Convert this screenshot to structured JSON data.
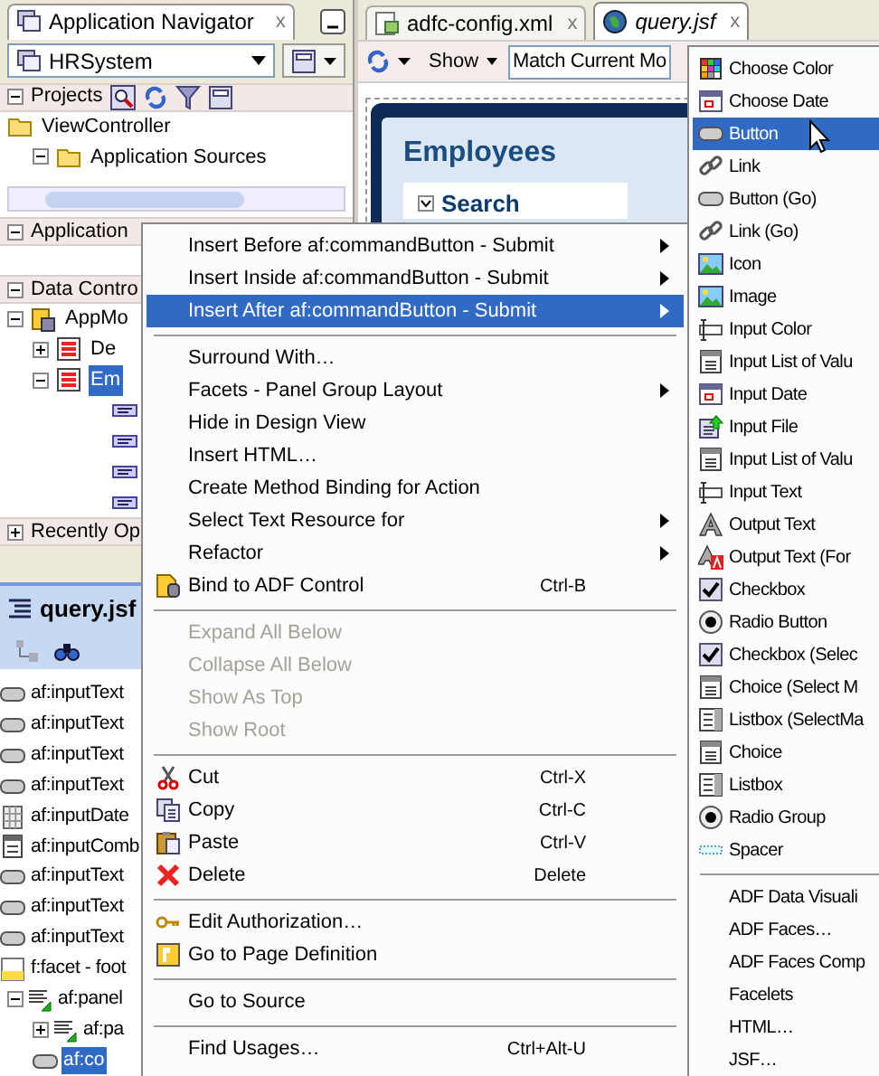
{
  "navigator": {
    "tab": {
      "label": "Application Navigator",
      "close": "x"
    },
    "application": "HRSystem",
    "projects": {
      "title": "Projects",
      "expanded": true,
      "tree": [
        {
          "label": "ViewController",
          "children": [
            {
              "label": "Application Sources",
              "expanded": true
            }
          ]
        }
      ]
    },
    "resources": {
      "title": "Application",
      "expanded": true
    },
    "data_controls": {
      "title": "Data Contro",
      "expanded": true,
      "tree": [
        {
          "label": "AppMo",
          "expanded": true,
          "selected": false,
          "children": [
            {
              "label": "De",
              "expanded": false,
              "selected": false
            },
            {
              "label": "Em",
              "expanded": true,
              "selected": true
            }
          ]
        }
      ]
    },
    "recent": {
      "title": "Recently Op",
      "expanded": false
    }
  },
  "structure": {
    "title": "query.jsf",
    "items": [
      {
        "kind": "text",
        "label": "af:inputText",
        "selected": false
      },
      {
        "kind": "text",
        "label": "af:inputText",
        "selected": false
      },
      {
        "kind": "text",
        "label": "af:inputText",
        "selected": false
      },
      {
        "kind": "text",
        "label": "af:inputText",
        "selected": false
      },
      {
        "kind": "date",
        "label": "af:inputDate",
        "selected": false
      },
      {
        "kind": "combo",
        "label": "af:inputComb",
        "selected": false
      },
      {
        "kind": "text",
        "label": "af:inputText",
        "selected": false
      },
      {
        "kind": "text",
        "label": "af:inputText",
        "selected": false
      },
      {
        "kind": "text",
        "label": "af:inputText",
        "selected": false
      },
      {
        "kind": "facet",
        "label": "f:facet - foot",
        "selected": false,
        "children": [
          {
            "kind": "panel",
            "label": "af:panel",
            "selected": false,
            "expanded": true,
            "children": [
              {
                "kind": "panel",
                "label": "af:pa",
                "selected": false,
                "expanded": false
              },
              {
                "kind": "button",
                "label": "af:co",
                "selected": true
              }
            ]
          }
        ]
      }
    ]
  },
  "editor": {
    "tabs": [
      {
        "label": "adfc-config.xml",
        "selected": false,
        "close": "x"
      },
      {
        "label": "query.jsf",
        "selected": true,
        "close": "x"
      }
    ],
    "show": "Show",
    "filter": "Match Current Mo",
    "page_title": "Employees",
    "section": "Search"
  },
  "context_menu": [
    {
      "kind": "item",
      "label": "Insert Before af:commandButton - Submit",
      "submenu": true,
      "selected": false,
      "disabled": false
    },
    {
      "kind": "item",
      "label": "Insert Inside af:commandButton - Submit",
      "submenu": true,
      "selected": false,
      "disabled": false
    },
    {
      "kind": "item",
      "label": "Insert After af:commandButton - Submit",
      "submenu": true,
      "selected": true,
      "disabled": false
    },
    {
      "kind": "separator"
    },
    {
      "kind": "item",
      "label": "Surround With…",
      "submenu": false,
      "selected": false,
      "disabled": false
    },
    {
      "kind": "item",
      "label": "Facets - Panel Group Layout",
      "submenu": true,
      "selected": false,
      "disabled": false
    },
    {
      "kind": "item",
      "label": "Hide in Design View",
      "submenu": false,
      "selected": false,
      "disabled": false
    },
    {
      "kind": "item",
      "label": "Insert HTML…",
      "submenu": false,
      "selected": false,
      "disabled": false
    },
    {
      "kind": "item",
      "label": "Create Method Binding for Action",
      "submenu": false,
      "selected": false,
      "disabled": false
    },
    {
      "kind": "item",
      "label": "Select Text Resource for",
      "submenu": true,
      "selected": false,
      "disabled": false
    },
    {
      "kind": "item",
      "label": "Refactor",
      "submenu": true,
      "selected": false,
      "disabled": false
    },
    {
      "kind": "item",
      "label": "Bind to ADF Control",
      "shortcut": "Ctrl-B",
      "submenu": false,
      "selected": false,
      "disabled": false
    },
    {
      "kind": "separator"
    },
    {
      "kind": "item",
      "label": "Expand All Below",
      "submenu": false,
      "selected": false,
      "disabled": true
    },
    {
      "kind": "item",
      "label": "Collapse All Below",
      "submenu": false,
      "selected": false,
      "disabled": true
    },
    {
      "kind": "item",
      "label": "Show As Top",
      "submenu": false,
      "selected": false,
      "disabled": true
    },
    {
      "kind": "item",
      "label": "Show Root",
      "submenu": false,
      "selected": false,
      "disabled": true
    },
    {
      "kind": "separator"
    },
    {
      "kind": "item",
      "label": "Cut",
      "shortcut": "Ctrl-X",
      "submenu": false,
      "selected": false,
      "disabled": false
    },
    {
      "kind": "item",
      "label": "Copy",
      "shortcut": "Ctrl-C",
      "submenu": false,
      "selected": false,
      "disabled": false
    },
    {
      "kind": "item",
      "label": "Paste",
      "shortcut": "Ctrl-V",
      "submenu": false,
      "selected": false,
      "disabled": false
    },
    {
      "kind": "item",
      "label": "Delete",
      "shortcut": "Delete",
      "submenu": false,
      "selected": false,
      "disabled": false
    },
    {
      "kind": "separator"
    },
    {
      "kind": "item",
      "label": "Edit Authorization…",
      "submenu": false,
      "selected": false,
      "disabled": false
    },
    {
      "kind": "item",
      "label": "Go to Page Definition",
      "submenu": false,
      "selected": false,
      "disabled": false
    },
    {
      "kind": "separator"
    },
    {
      "kind": "item",
      "label": "Go to Source",
      "submenu": false,
      "selected": false,
      "disabled": false
    },
    {
      "kind": "separator"
    },
    {
      "kind": "item",
      "label": "Find Usages…",
      "shortcut": "Ctrl+Alt-U",
      "submenu": false,
      "selected": false,
      "disabled": false
    }
  ],
  "submenu": [
    {
      "kind": "item",
      "label": "Choose Color",
      "selected": false
    },
    {
      "kind": "item",
      "label": "Choose Date",
      "selected": false
    },
    {
      "kind": "item",
      "label": "Button",
      "selected": true
    },
    {
      "kind": "item",
      "label": "Link",
      "selected": false
    },
    {
      "kind": "item",
      "label": "Button (Go)",
      "selected": false
    },
    {
      "kind": "item",
      "label": "Link (Go)",
      "selected": false
    },
    {
      "kind": "item",
      "label": "Icon",
      "selected": false
    },
    {
      "kind": "item",
      "label": "Image",
      "selected": false
    },
    {
      "kind": "item",
      "label": "Input Color",
      "selected": false
    },
    {
      "kind": "item",
      "label": "Input List of Valu",
      "selected": false
    },
    {
      "kind": "item",
      "label": "Input Date",
      "selected": false
    },
    {
      "kind": "item",
      "label": "Input File",
      "selected": false
    },
    {
      "kind": "item",
      "label": "Input List of Valu",
      "selected": false
    },
    {
      "kind": "item",
      "label": "Input Text",
      "selected": false
    },
    {
      "kind": "item",
      "label": "Output Text",
      "selected": false
    },
    {
      "kind": "item",
      "label": "Output Text (For",
      "selected": false
    },
    {
      "kind": "item",
      "label": "Checkbox",
      "selected": false
    },
    {
      "kind": "item",
      "label": "Radio Button",
      "selected": false
    },
    {
      "kind": "item",
      "label": "Checkbox (Selec",
      "selected": false
    },
    {
      "kind": "item",
      "label": "Choice (Select M",
      "selected": false
    },
    {
      "kind": "item",
      "label": "Listbox (SelectMa",
      "selected": false
    },
    {
      "kind": "item",
      "label": "Choice",
      "selected": false
    },
    {
      "kind": "item",
      "label": "Listbox",
      "selected": false
    },
    {
      "kind": "item",
      "label": "Radio Group",
      "selected": false
    },
    {
      "kind": "item",
      "label": "Spacer",
      "selected": false
    },
    {
      "kind": "separator"
    },
    {
      "kind": "item",
      "label": "ADF Data Visuali",
      "selected": false
    },
    {
      "kind": "item",
      "label": "ADF Faces…",
      "selected": false
    },
    {
      "kind": "item",
      "label": "ADF Faces Comp",
      "selected": false
    },
    {
      "kind": "item",
      "label": "Facelets",
      "selected": false
    },
    {
      "kind": "item",
      "label": "HTML…",
      "selected": false
    },
    {
      "kind": "item",
      "label": "JSF…",
      "selected": false
    }
  ]
}
